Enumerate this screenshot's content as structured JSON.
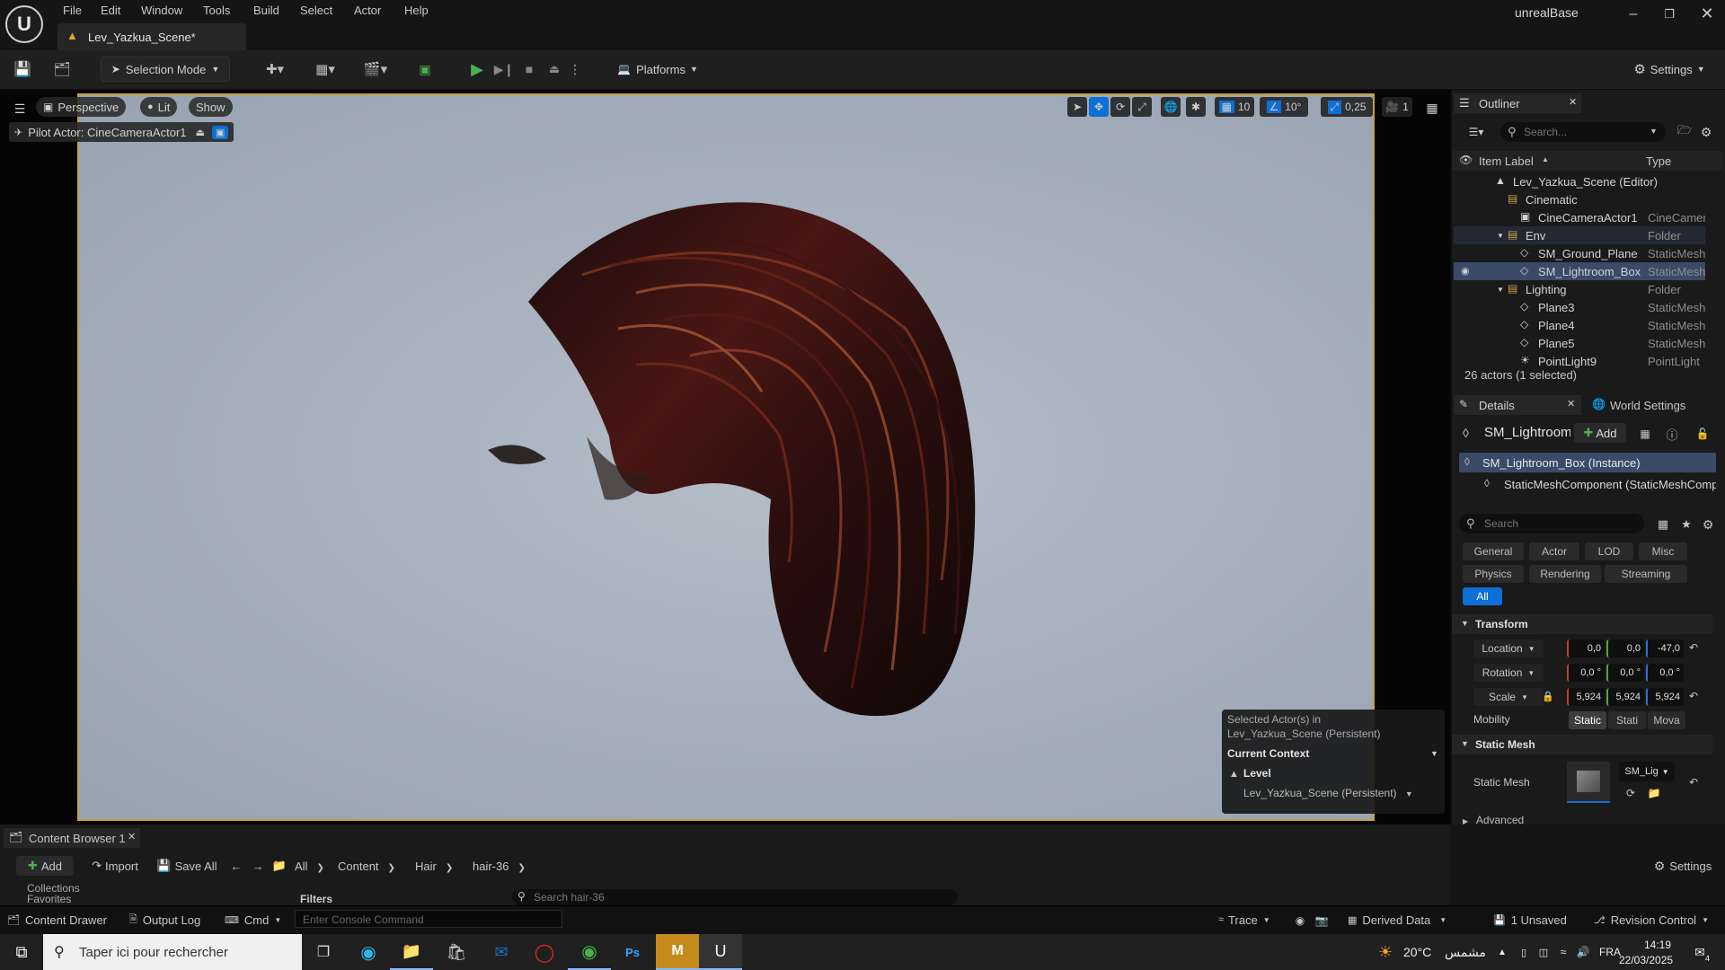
{
  "window": {
    "project_title": "unrealBase",
    "tab_title": "Lev_Yazkua_Scene*"
  },
  "menu": [
    "File",
    "Edit",
    "Window",
    "Tools",
    "Build",
    "Select",
    "Actor",
    "Help"
  ],
  "toolbar": {
    "selection_mode": "Selection Mode",
    "platforms": "Platforms",
    "settings": "Settings"
  },
  "viewport": {
    "perspective": "Perspective",
    "lit": "Lit",
    "show": "Show",
    "pilot_label": "Pilot Actor: CineCameraActor1",
    "grid_snap": "10",
    "rot_snap": "10°",
    "scale_snap": "0,25",
    "camera_speed": "1",
    "popup": {
      "line1": "Selected Actor(s) in",
      "line2": "Lev_Yazkua_Scene (Persistent)",
      "context_title": "Current Context",
      "level_label": "Level",
      "level_value": "Lev_Yazkua_Scene (Persistent)"
    }
  },
  "outliner": {
    "tab": "Outliner",
    "search_placeholder": "Search...",
    "col_label": "Item Label",
    "col_type": "Type",
    "rows": [
      {
        "label": "Lev_Yazkua_Scene (Editor)",
        "type": "",
        "indent": 0,
        "icon": "level"
      },
      {
        "label": "Cinematic",
        "type": "",
        "indent": 1,
        "icon": "folder"
      },
      {
        "label": "CineCameraActor1",
        "type": "CineCamera",
        "indent": 2,
        "icon": "camera"
      },
      {
        "label": "Env",
        "type": "Folder",
        "indent": 1,
        "icon": "folder"
      },
      {
        "label": "SM_Ground_Plane",
        "type": "StaticMesh",
        "indent": 2,
        "icon": "mesh"
      },
      {
        "label": "SM_Lightroom_Box",
        "type": "StaticMesh",
        "indent": 2,
        "icon": "mesh",
        "selected": true
      },
      {
        "label": "Lighting",
        "type": "Folder",
        "indent": 1,
        "icon": "folder"
      },
      {
        "label": "Plane3",
        "type": "StaticMesh",
        "indent": 2,
        "icon": "mesh"
      },
      {
        "label": "Plane4",
        "type": "StaticMesh",
        "indent": 2,
        "icon": "mesh"
      },
      {
        "label": "Plane5",
        "type": "StaticMesh",
        "indent": 2,
        "icon": "mesh"
      },
      {
        "label": "PointLight9",
        "type": "PointLight",
        "indent": 2,
        "icon": "light"
      }
    ],
    "status": "26 actors (1 selected)"
  },
  "details": {
    "tab": "Details",
    "world_tab": "World Settings",
    "actor_name": "SM_Lightroom",
    "add": "Add",
    "instance": "SM_Lightroom_Box (Instance)",
    "component": "StaticMeshComponent (StaticMeshComp",
    "search_placeholder": "Search",
    "filters_row1": [
      "General",
      "Actor",
      "LOD",
      "Misc"
    ],
    "filters_row2": [
      "Physics",
      "Rendering",
      "Streaming"
    ],
    "filter_all": "All",
    "transform_title": "Transform",
    "location_label": "Location",
    "location": [
      "0,0",
      "0,0",
      "-47,0"
    ],
    "rotation_label": "Rotation",
    "rotation": [
      "0,0 °",
      "0,0 °",
      "0,0 °"
    ],
    "scale_label": "Scale",
    "scale": [
      "5,924",
      "5,924",
      "5,924"
    ],
    "mobility_label": "Mobility",
    "mobility": [
      "Static",
      "Stati",
      "Mova"
    ],
    "static_mesh_title": "Static Mesh",
    "static_mesh_label": "Static Mesh",
    "static_mesh_value": "SM_Lig",
    "advanced": "Advanced"
  },
  "content_browser": {
    "tab": "Content Browser 1",
    "add": "Add",
    "import": "Import",
    "save_all": "Save All",
    "path": [
      "All",
      "Content",
      "Hair",
      "hair-36"
    ],
    "settings": "Settings",
    "collections": "Collections",
    "favorites": "Favorites",
    "filters": "Filters",
    "search_placeholder": "Search hair-36"
  },
  "statusbar": {
    "content_drawer": "Content Drawer",
    "output_log": "Output Log",
    "cmd": "Cmd",
    "console_placeholder": "Enter Console Command",
    "trace": "Trace",
    "derived_data": "Derived Data",
    "unsaved": "1 Unsaved",
    "revision": "Revision Control"
  },
  "taskbar": {
    "search_placeholder": "Taper ici pour rechercher",
    "weather": "20°C",
    "weather_text": "مشمس",
    "lang": "FRA",
    "time": "14:19",
    "date": "22/03/2025",
    "notif_count": "4"
  },
  "colors": {
    "accent_blue": "#0e6fd6",
    "viewport_border": "#c8a13a",
    "selected_row": "#3a4a68",
    "location_x": "#c2392f",
    "location_y": "#4fa83a",
    "location_z": "#2c6fd1"
  }
}
